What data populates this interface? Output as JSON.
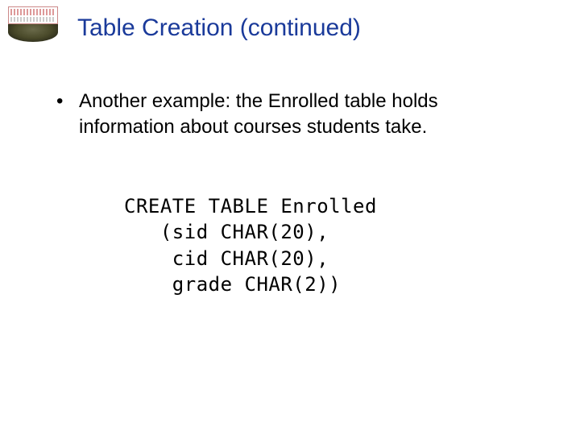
{
  "title": "Table Creation (continued)",
  "bullet": {
    "marker": "•",
    "text": "Another example: the Enrolled table holds information about courses students take."
  },
  "code": {
    "line1": "CREATE TABLE Enrolled",
    "line2": "   (sid CHAR(20),",
    "line3": "    cid CHAR(20),",
    "line4": "    grade CHAR(2))"
  }
}
